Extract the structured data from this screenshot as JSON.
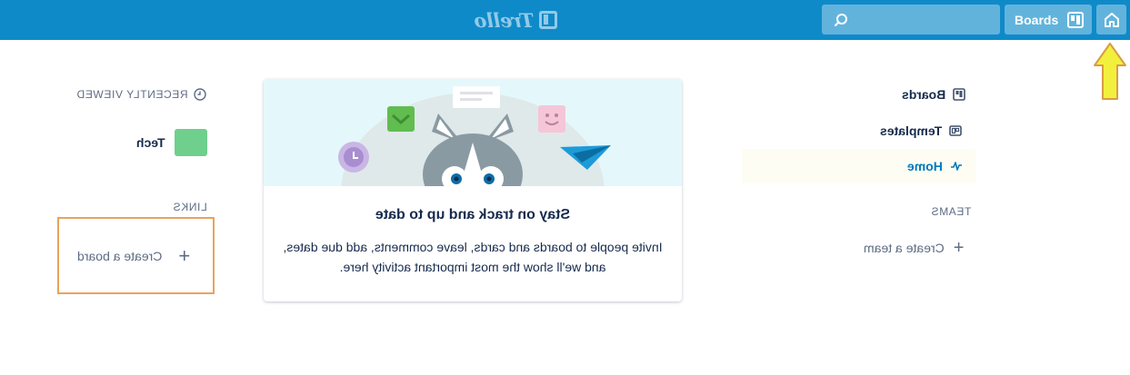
{
  "header": {
    "logo_text": "Trello",
    "boards_label": "Boards",
    "search_placeholder": ""
  },
  "recently_viewed": {
    "title": "RECENTLY VIEWED",
    "items": [
      {
        "label": "Tech",
        "color": "#6fcf8c"
      }
    ]
  },
  "links": {
    "title": "LINKS",
    "create_board": "Create a board"
  },
  "card": {
    "title": "Stay on track and up to date",
    "body": "Invite people to boards and cards, leave comments, add due dates, and we'll show the most important activity here."
  },
  "nav": {
    "boards": "Boards",
    "templates": "Templates",
    "home": "Home",
    "teams_title": "TEAMS",
    "create_team": "Create a team"
  },
  "colors": {
    "header": "#0f8ac9",
    "highlight_border": "#e8a35e",
    "arrow": "#f2f03c",
    "home_link": "#0079bf"
  },
  "icons": {
    "search": "search-icon",
    "boards": "board-icon",
    "home": "house-icon",
    "clock": "clock-icon",
    "templates": "template-icon",
    "activity": "activity-icon",
    "plus": "plus-icon"
  }
}
